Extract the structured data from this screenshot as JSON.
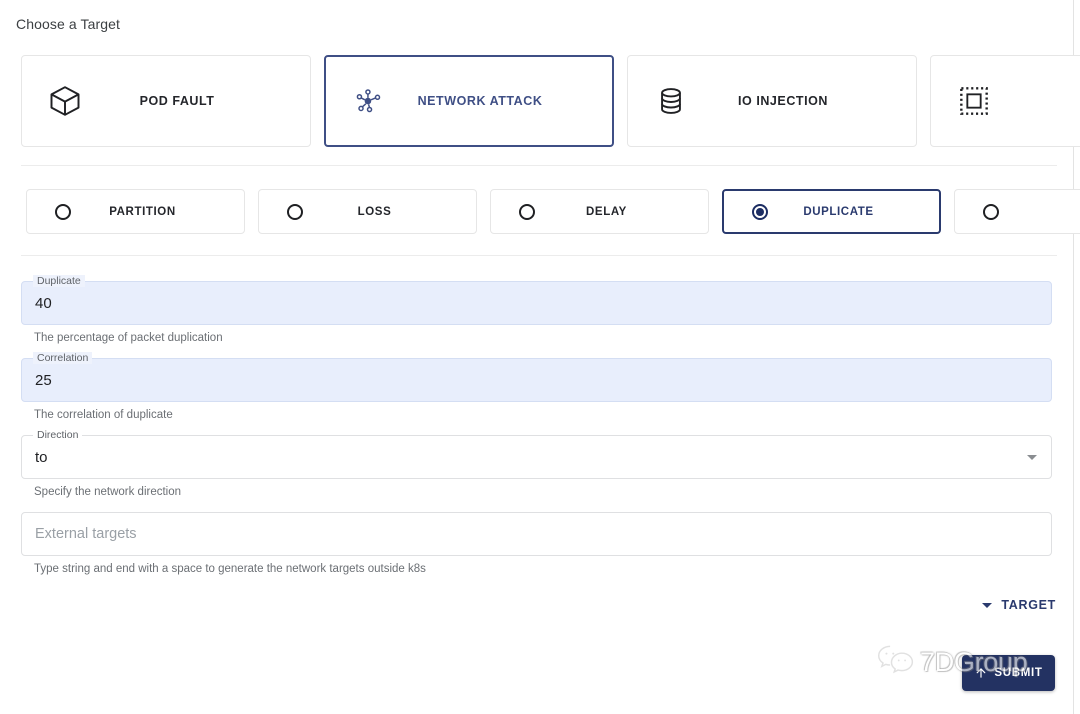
{
  "header": {
    "title": "Choose a Target"
  },
  "targets": {
    "items": [
      {
        "label": "POD FAULT",
        "icon": "cube-icon",
        "selected": false
      },
      {
        "label": "NETWORK ATTACK",
        "icon": "network-nodes-icon",
        "selected": true
      },
      {
        "label": "IO INJECTION",
        "icon": "database-icon",
        "selected": false
      },
      {
        "label": "",
        "icon": "dashed-square-icon",
        "selected": false
      }
    ]
  },
  "actions": {
    "items": [
      {
        "label": "PARTITION",
        "selected": false
      },
      {
        "label": "LOSS",
        "selected": false
      },
      {
        "label": "DELAY",
        "selected": false
      },
      {
        "label": "DUPLICATE",
        "selected": true
      },
      {
        "label": "",
        "selected": false
      }
    ]
  },
  "form": {
    "duplicate": {
      "label": "Duplicate",
      "value": "40",
      "helper": "The percentage of packet duplication"
    },
    "correlation": {
      "label": "Correlation",
      "value": "25",
      "helper": "The correlation of duplicate"
    },
    "direction": {
      "label": "Direction",
      "value": "to",
      "helper": "Specify the network direction"
    },
    "external_targets": {
      "placeholder": "External targets",
      "value": "",
      "helper": "Type string and end with a space to generate the network targets outside k8s"
    }
  },
  "target_toggle": {
    "label": "TARGET",
    "icon": "chevron-down-icon"
  },
  "submit": {
    "label": "SUBMIT",
    "icon": "upload-icon"
  },
  "watermark": {
    "text": "7DGroup",
    "icon": "wechat-icon"
  },
  "colors": {
    "accent": "#3f4f85",
    "accent_dark": "#2a3a6e",
    "submit_bg": "#233262",
    "autofill_bg": "#e8eefc",
    "border": "#e6e6e6",
    "text": "#24262b",
    "helper_text": "#6b6f74",
    "placeholder": "#9aa0a6"
  }
}
